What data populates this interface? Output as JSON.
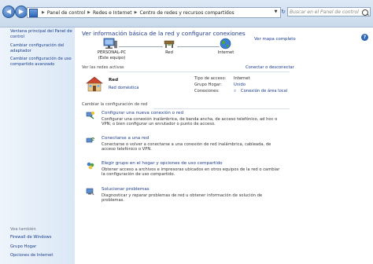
{
  "address": {
    "crumbs": [
      "Panel de control",
      "Redes e Internet",
      "Centro de redes y recursos compartidos"
    ],
    "search_placeholder": "Buscar en el Panel de control"
  },
  "leftnav": {
    "items": [
      "Ventana principal del Panel de control",
      "Cambiar configuración del adaptador",
      "Cambiar configuración de uso compartido avanzado"
    ],
    "see_also": "Vea también",
    "see_items": [
      "Firewall de Windows",
      "Grupo Hogar",
      "Opciones de Internet"
    ]
  },
  "main": {
    "title": "Ver información básica de la red y configurar conexiones",
    "map_link": "Ver mapa completo",
    "nodes": [
      {
        "name": "PERSONAL-PC",
        "sub": "(Este equipo)"
      },
      {
        "name": "Red",
        "sub": ""
      },
      {
        "name": "Internet",
        "sub": ""
      }
    ],
    "active_label": "Ver las redes activas",
    "connect_link": "Conectar o desconectar",
    "network": {
      "name": "Red",
      "type": "Red doméstica"
    },
    "props": [
      {
        "k": "Tipo de acceso:",
        "v": "Internet",
        "link": false
      },
      {
        "k": "Grupo Hogar:",
        "v": "Unido",
        "link": true
      },
      {
        "k": "Conexiones:",
        "v": "Conexión de área local",
        "link": true
      }
    ],
    "change_label": "Cambiar la configuración de red",
    "tasks": [
      {
        "link": "Configurar una nueva conexión o red",
        "desc": "Configurar una conexión inalámbrica, de banda ancha, de acceso telefónico, ad hoc o VPN; o bien configurar un enrutador o punto de acceso."
      },
      {
        "link": "Conectarse a una red",
        "desc": "Conectarse o volver a conectarse a una conexión de red inalámbrica, cableada, de acceso telefónico o VPN."
      },
      {
        "link": "Elegir grupo en el hogar y opciones de uso compartido",
        "desc": "Obtener acceso a archivos e impresoras ubicados en otros equipos de la red o cambiar la configuración de uso compartido."
      },
      {
        "link": "Solucionar problemas",
        "desc": "Diagnosticar y reparar problemas de red u obtener información de solución de problemas."
      }
    ]
  }
}
